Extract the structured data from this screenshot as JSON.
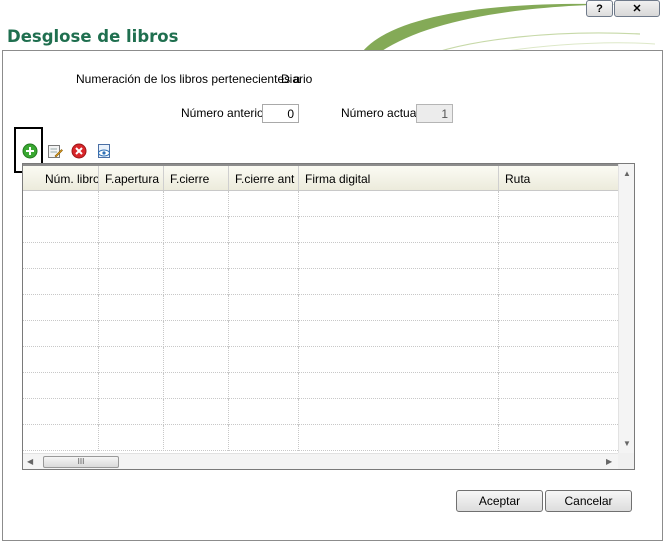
{
  "window": {
    "help_label": "?",
    "close_label": "✕"
  },
  "dialog": {
    "title": "Desglose de libros",
    "numeration_label": "Numeración de los libros pertenecientes a",
    "numeration_value": "Diario"
  },
  "fields": {
    "previous_label": "Número anterior",
    "previous_value": "0",
    "current_label": "Número actual",
    "current_value": "1"
  },
  "toolbar": {
    "icons": [
      "add-icon",
      "edit-icon",
      "delete-icon",
      "view-icon"
    ]
  },
  "grid": {
    "columns": [
      "Núm. libro",
      "F.apertura",
      "F.cierre",
      "F.cierre ant",
      "Firma digital",
      "Ruta"
    ],
    "empty_rows": 10,
    "scroll_thumb_label": "III",
    "scroll_up": "▲",
    "scroll_down": "▼",
    "scroll_left": "◀",
    "scroll_right": "▶"
  },
  "buttons": {
    "accept": "Aceptar",
    "cancel": "Cancelar"
  },
  "colors": {
    "title": "#1f6f4f",
    "swoosh": "#6e9b3a",
    "add": "#3aa832",
    "delete": "#d8262a"
  }
}
